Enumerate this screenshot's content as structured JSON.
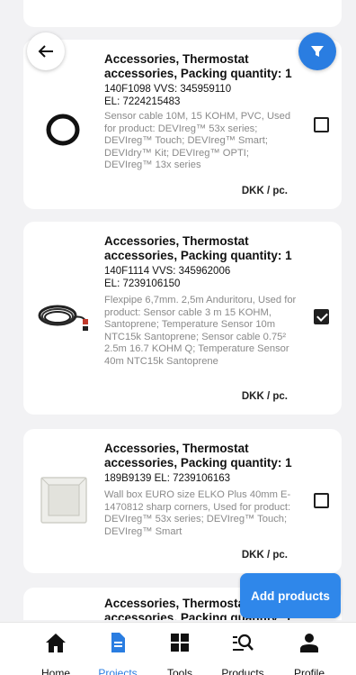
{
  "header": {
    "back_icon": "arrow-left-icon",
    "filter_icon": "filter-icon",
    "filter_color": "#2a7de1"
  },
  "products": [
    {
      "title": "Accessories, Thermostat accessories, Packing quantity: 1",
      "codes_line1": "140F1098  VVS: 345959110",
      "codes_line2": "EL: 7224215483",
      "description": "Sensor cable 10M, 15 KOHM, PVC, Used for product: DEVIreg™ 53x series; DEVIreg™ Touch; DEVIreg™ Smart; DEVIdry™ Kit; DEVIreg™ OPTI; DEVIreg™ 13x series",
      "price": "DKK / pc.",
      "checked": false
    },
    {
      "title": "Accessories, Thermostat accessories, Packing quantity: 1",
      "codes_line1": "140F1114  VVS: 345962006",
      "codes_line2": "EL: 7239106150",
      "description": "Flexpipe 6,7mm. 2,5m Anduritoru, Used for product: Sensor cable 3 m 15 KOHM, Santoprene; Temperature Sensor 10m NTC15k Santoprene; Sensor cable 0.75² 2.5m 16.7 KOHM Q; Temperature Sensor 40m NTC15k Santoprene",
      "price": "DKK / pc.",
      "checked": true
    },
    {
      "title": "Accessories, Thermostat accessories, Packing quantity: 1",
      "codes_line1": "189B9139  EL: 7239106163",
      "codes_line2": "",
      "description": "Wall box EURO size ELKO Plus 40mm E-1470812 sharp corners, Used for product: DEVIreg™ 53x series; DEVIreg™ Touch; DEVIreg™ Smart",
      "price": "DKK / pc.",
      "checked": false
    },
    {
      "title": "Accessories, Thermostat accessories, Packing quantity: 1"
    }
  ],
  "add_button": {
    "label": "Add products",
    "color": "#2f87ea"
  },
  "nav": [
    {
      "label": "Home",
      "icon": "home-icon"
    },
    {
      "label": "Projects",
      "icon": "document-icon",
      "active": true
    },
    {
      "label": "Tools",
      "icon": "grid-icon"
    },
    {
      "label": "Products",
      "icon": "search-list-icon"
    },
    {
      "label": "Profile",
      "icon": "person-icon"
    }
  ]
}
